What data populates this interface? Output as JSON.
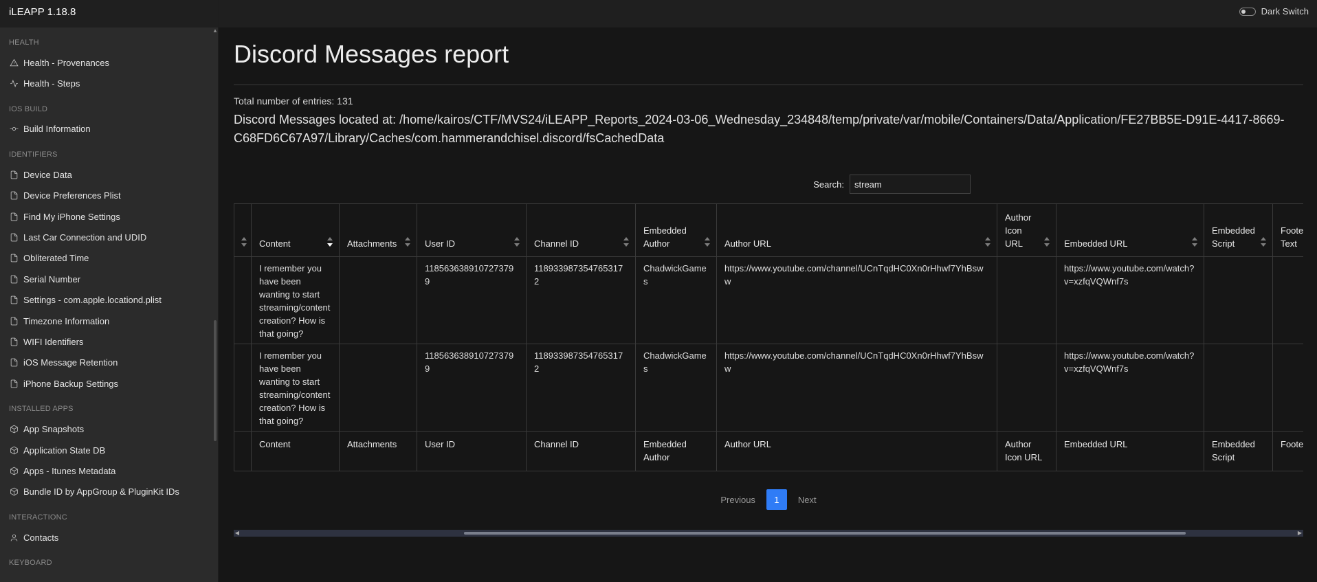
{
  "app": {
    "title": "iLEAPP 1.18.8",
    "dark_switch_label": "Dark Switch"
  },
  "sidebar": {
    "sections": [
      {
        "title": "HEALTH",
        "items": [
          {
            "label": "Health - Provenances",
            "icon": "warning-triangle-icon"
          },
          {
            "label": "Health - Steps",
            "icon": "activity-icon"
          }
        ]
      },
      {
        "title": "IOS BUILD",
        "items": [
          {
            "label": "Build Information",
            "icon": "git-commit-icon"
          }
        ]
      },
      {
        "title": "IDENTIFIERS",
        "items": [
          {
            "label": "Device Data",
            "icon": "file-icon"
          },
          {
            "label": "Device Preferences Plist",
            "icon": "file-icon"
          },
          {
            "label": "Find My iPhone Settings",
            "icon": "file-icon"
          },
          {
            "label": "Last Car Connection and UDID",
            "icon": "file-icon"
          },
          {
            "label": "Obliterated Time",
            "icon": "file-icon"
          },
          {
            "label": "Serial Number",
            "icon": "file-icon"
          },
          {
            "label": "Settings - com.apple.locationd.plist",
            "icon": "file-icon"
          },
          {
            "label": "Timezone Information",
            "icon": "file-icon"
          },
          {
            "label": "WIFI Identifiers",
            "icon": "file-icon"
          },
          {
            "label": "iOS Message Retention",
            "icon": "file-icon"
          },
          {
            "label": "iPhone Backup Settings",
            "icon": "file-icon"
          }
        ]
      },
      {
        "title": "INSTALLED APPS",
        "items": [
          {
            "label": "App Snapshots",
            "icon": "package-icon"
          },
          {
            "label": "Application State DB",
            "icon": "package-icon"
          },
          {
            "label": "Apps - Itunes Metadata",
            "icon": "package-icon"
          },
          {
            "label": "Bundle ID by AppGroup & PluginKit IDs",
            "icon": "package-icon"
          }
        ]
      },
      {
        "title": "INTERACTIONC",
        "items": [
          {
            "label": "Contacts",
            "icon": "user-icon"
          }
        ]
      },
      {
        "title": "KEYBOARD",
        "items": []
      }
    ]
  },
  "report": {
    "title": "Discord Messages report",
    "total_entries": "Total number of entries: 131",
    "location": "Discord Messages located at: /home/kairos/CTF/MVS24/iLEAPP_Reports_2024-03-06_Wednesday_234848/temp/private/var/mobile/Containers/Data/Application/FE27BB5E-D91E-4417-8669-C68FD6C67A97/Library/Caches/com.hammerandchisel.discord/fsCachedData",
    "search_label": "Search:",
    "search_value": "stream"
  },
  "table": {
    "columns": [
      "",
      "Content",
      "Attachments",
      "User ID",
      "Channel ID",
      "Embedded Author",
      "Author URL",
      "Author Icon URL",
      "Embedded URL",
      "Embedded Script",
      "Footer Text"
    ],
    "rows": [
      [
        "",
        "I remember you have been wanting to start streaming/content creation? How is that going?",
        "",
        "1185636389107273799",
        "1189339873547653172",
        "ChadwickGames",
        "https://www.youtube.com/channel/UCnTqdHC0Xn0rHhwf7YhBsww",
        "",
        "https://www.youtube.com/watch?v=xzfqVQWnf7s",
        "",
        ""
      ],
      [
        "",
        "I remember you have been wanting to start streaming/content creation? How is that going?",
        "",
        "1185636389107273799",
        "1189339873547653172",
        "ChadwickGames",
        "https://www.youtube.com/channel/UCnTqdHC0Xn0rHhwf7YhBsww",
        "",
        "https://www.youtube.com/watch?v=xzfqVQWnf7s",
        "",
        ""
      ]
    ],
    "sorted_column": "Content"
  },
  "pagination": {
    "previous": "Previous",
    "current": "1",
    "next": "Next"
  }
}
